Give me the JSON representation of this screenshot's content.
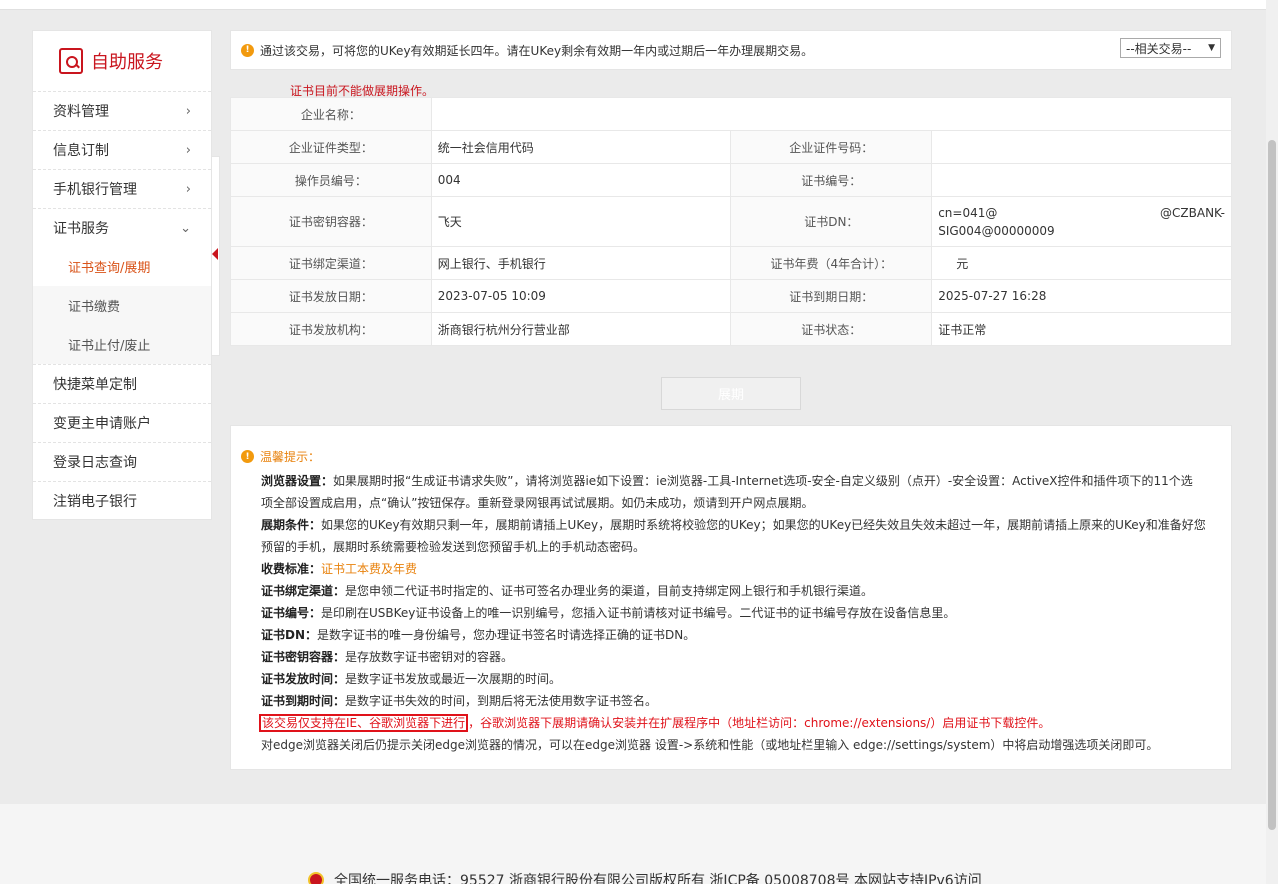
{
  "sidebar": {
    "title": "自助服务",
    "items": [
      {
        "label": "资料管理",
        "chevron": "›"
      },
      {
        "label": "信息订制",
        "chevron": "›"
      },
      {
        "label": "手机银行管理",
        "chevron": "›"
      },
      {
        "label": "证书服务",
        "chevron": "⌄"
      },
      {
        "label": "证书查询/展期"
      },
      {
        "label": "证书缴费"
      },
      {
        "label": "证书止付/废止"
      },
      {
        "label": "快捷菜单定制"
      },
      {
        "label": "变更主申请账户"
      },
      {
        "label": "登录日志查询"
      },
      {
        "label": "注销电子银行"
      }
    ]
  },
  "notice": {
    "text": "通过该交易，可将您的UKey有效期延长四年。请在UKey剩余有效期一年内或过期后一年办理展期交易。",
    "related_select": "--相关交易--"
  },
  "cert_warning": "证书目前不能做展期操作。",
  "info": {
    "company_name_label": "企业名称：",
    "company_name": "",
    "id_type_label": "企业证件类型：",
    "id_type": "统一社会信用代码",
    "id_no_label": "企业证件号码：",
    "id_no": "",
    "operator_label": "操作员编号：",
    "operator": "004",
    "cert_no_label": "证书编号：",
    "cert_no": "",
    "container_label": "证书密钥容器：",
    "container": "飞天",
    "dn_label": "证书DN：",
    "dn_line1a": "cn=041@",
    "dn_line1b": "@CZBANK-",
    "dn_line2": "SIG004@00000009",
    "channel_label": "证书绑定渠道：",
    "channel": "网上银行、手机银行",
    "fee_label": "证书年费（4年合计）：",
    "fee": "元",
    "issue_date_label": "证书发放日期：",
    "issue_date": "2023-07-05 10:09",
    "expire_date_label": "证书到期日期：",
    "expire_date": "2025-07-27 16:28",
    "issuer_label": "证书发放机构：",
    "issuer": "浙商银行杭州分行营业部",
    "status_label": "证书状态：",
    "status": "证书正常"
  },
  "extend_button": "展期",
  "tips": {
    "title": "温馨提示：",
    "browser_h": "浏览器设置：",
    "browser_t1": "如果展期时报“生成证书请求失败”，请将浏览器ie如下设置：ie浏览器-工具-Internet选项-安全-自定义级别（点开）-安全设置：ActiveX控件和插件项下的11个选",
    "browser_t2": "项全部设置成启用，点“确认”按钮保存。重新登录网银再试试展期。如仍未成功，烦请到开户网点展期。",
    "cond_h": "展期条件：",
    "cond_t1": "如果您的UKey有效期只剩一年，展期前请插上UKey，展期时系统将校验您的UKey；如果您的UKey已经失效且失效未超过一年，展期前请插上原来的UKey和准备好您",
    "cond_t2": "预留的手机，展期时系统需要检验发送到您预留手机上的手机动态密码。",
    "fee_h": "收费标准：",
    "fee_t": "证书工本费及年费",
    "chan_h": "证书绑定渠道：",
    "chan_t": "是您申领二代证书时指定的、证书可签名办理业务的渠道，目前支持绑定网上银行和手机银行渠道。",
    "no_h": "证书编号：",
    "no_t": "是印刷在USBKey证书设备上的唯一识别编号，您插入证书前请核对证书编号。二代证书的证书编号存放在设备信息里。",
    "dn_h": "证书DN：",
    "dn_t": "是数字证书的唯一身份编号，您办理证书签名时请选择正确的证书DN。",
    "cont_h": "证书密钥容器：",
    "cont_t": "是存放数字证书密钥对的容器。",
    "issue_h": "证书发放时间：",
    "issue_t": "是数字证书发放或最近一次展期的时间。",
    "exp_h": "证书到期时间：",
    "exp_t": "是数字证书失效的时间，到期后将无法使用数字证书签名。",
    "red_box": "该交易仅支持在IE、谷歌浏览器下进行",
    "red_rest": "，谷歌浏览器下展期请确认安装并在扩展程序中（地址栏访问：chrome://extensions/）启用证书下载控件。",
    "edge": "对edge浏览器关闭后仍提示关闭edge浏览器的情况，可以在edge浏览器 设置->系统和性能（或地址栏里输入 edge://settings/system）中将启动增强选项关闭即可。"
  },
  "footer": "全国统一服务电话：95527   浙商银行股份有限公司版权所有 浙ICP备 05008708号 本网站支持IPv6访问"
}
